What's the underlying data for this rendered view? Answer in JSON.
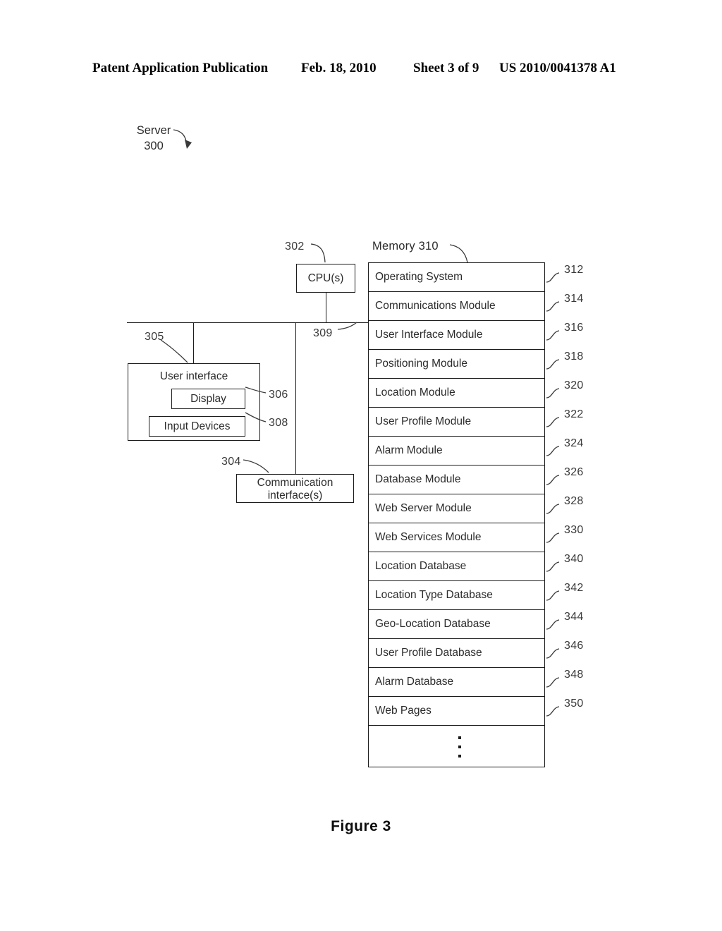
{
  "header": {
    "publication": "Patent Application Publication",
    "date": "Feb. 18, 2010",
    "sheet": "Sheet 3 of 9",
    "patent_number": "US 2010/0041378 A1"
  },
  "figure": {
    "caption": "Figure 3",
    "server_label": "Server",
    "server_ref": "300"
  },
  "blocks": {
    "cpu": {
      "label": "CPU(s)",
      "ref": "302"
    },
    "memory": {
      "label": "Memory 310"
    },
    "bus": {
      "ref": "309"
    },
    "user_interface": {
      "label": "User interface",
      "ref": "305",
      "display": {
        "label": "Display",
        "ref": "306"
      },
      "input_devices": {
        "label": "Input Devices",
        "ref": "308"
      }
    },
    "communication_interface": {
      "line1": "Communication",
      "line2": "interface(s)",
      "ref": "304"
    }
  },
  "memory_rows": [
    {
      "label": "Operating System",
      "ref": "312"
    },
    {
      "label": "Communications Module",
      "ref": "314"
    },
    {
      "label": "User Interface Module",
      "ref": "316"
    },
    {
      "label": "Positioning Module",
      "ref": "318"
    },
    {
      "label": "Location Module",
      "ref": "320"
    },
    {
      "label": "User Profile Module",
      "ref": "322"
    },
    {
      "label": "Alarm Module",
      "ref": "324"
    },
    {
      "label": "Database Module",
      "ref": "326"
    },
    {
      "label": "Web Server Module",
      "ref": "328"
    },
    {
      "label": "Web Services Module",
      "ref": "330"
    },
    {
      "label": "Location Database",
      "ref": "340"
    },
    {
      "label": "Location Type Database",
      "ref": "342"
    },
    {
      "label": "Geo-Location Database",
      "ref": "344"
    },
    {
      "label": "User Profile Database",
      "ref": "346"
    },
    {
      "label": "Alarm Database",
      "ref": "348"
    },
    {
      "label": "Web Pages",
      "ref": "350"
    }
  ],
  "colors": {
    "ink": "#1c1c1c",
    "text": "#2b2b2b",
    "leader": "#3a3a3a",
    "background": "#ffffff"
  }
}
